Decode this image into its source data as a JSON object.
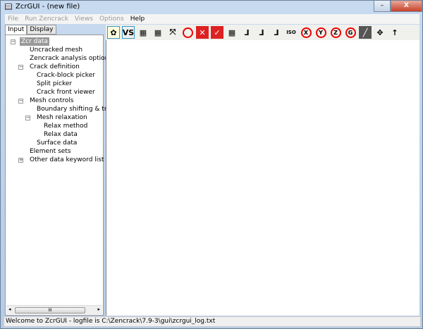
{
  "window": {
    "title": "ZcrGUI - (new file)",
    "minimize": "–",
    "maximize": "▢",
    "close": "X"
  },
  "menu": [
    "File",
    "Run Zencrack",
    "Views",
    "Options",
    "Help"
  ],
  "tabs": [
    "Input",
    "Display"
  ],
  "tree": {
    "root": "Zcr data",
    "items": [
      "Uncracked mesh",
      "Zencrack analysis options",
      "Crack definition",
      "Crack-block picker",
      "Split picker",
      "Crack front viewer",
      "Mesh controls",
      "Boundary shifting & transf",
      "Mesh relaxation",
      "Relax method",
      "Relax data",
      "Surface data",
      "Element sets",
      "Other data keyword list"
    ]
  },
  "toolbar": {
    "icons": [
      "model-icon",
      "vs-icon",
      "mesh-grid-icon",
      "mesh-grid-2-icon",
      "fit-view-icon",
      "rotate-icon",
      "delete-mesh-icon",
      "check-mesh-icon",
      "grid-icon",
      "axes-yx-icon",
      "axes-zy-icon",
      "axes-xz-icon",
      "axes-iso-icon",
      "rotate-x-icon",
      "rotate-y-icon",
      "rotate-z-icon",
      "rotate-g-icon",
      "curve-icon",
      "pan-icon",
      "up-arrow-icon"
    ],
    "vs_label": "VS",
    "x": "X",
    "y": "Y",
    "z": "Z",
    "g": "G",
    "iso": "ISO"
  },
  "scrollbar_grip": "III",
  "status": "Welcome to ZcrGUI - logfile is C:\\Zencrack\\7.9-3\\gui\\zcrgui_log.txt"
}
